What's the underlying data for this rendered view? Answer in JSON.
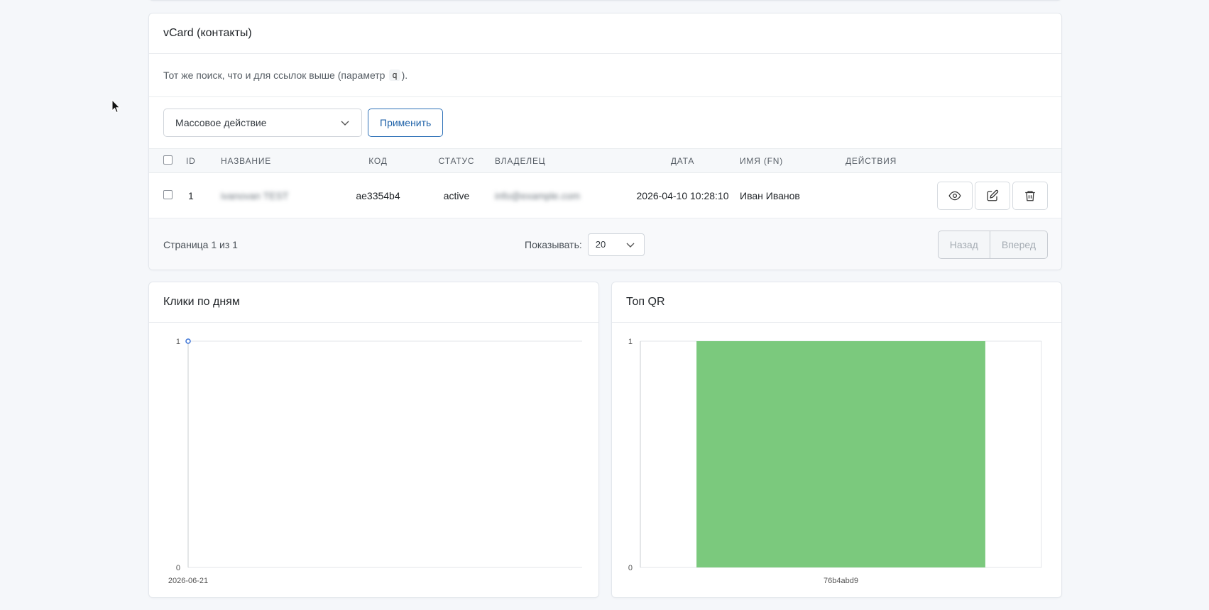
{
  "vcard": {
    "title": "vCard (контакты)",
    "hint_prefix": "Тот же поиск, что и для ссылок выше (параметр",
    "hint_code": "q",
    "hint_suffix": ").",
    "bulk_placeholder": "Массовое действие",
    "apply_label": "Применить",
    "columns": [
      "ID",
      "НАЗВАНИЕ",
      "КОД",
      "СТАТУС",
      "ВЛАДЕЛЕЦ",
      "ДАТА",
      "ИМЯ (FN)",
      "ДЕЙСТВИЯ"
    ],
    "rows": [
      {
        "id": "1",
        "name": "ivanovan TEST",
        "code": "ae3354b4",
        "status": "active",
        "owner": "info@example.com",
        "date": "2026-04-10 10:28:10",
        "fn": "Иван Иванов",
        "actions": [
          "eye-icon",
          "edit-icon",
          "trash-icon"
        ]
      }
    ],
    "footer": {
      "page_info": "Страница 1 из 1",
      "per_page_label": "Показывать:",
      "per_page_value": "20",
      "prev_label": "Назад",
      "next_label": "Вперед"
    }
  },
  "clicks_chart": {
    "title": "Клики по дням",
    "chart_data": {
      "type": "line",
      "x": [
        "2026-06-21"
      ],
      "series": [
        {
          "values": [
            1
          ]
        }
      ],
      "ylim": [
        0,
        1
      ],
      "yticks": [
        "0",
        "1"
      ],
      "color": "#3b73d6",
      "grid": true
    }
  },
  "top_qr_chart": {
    "title": "Топ QR",
    "chart_data": {
      "type": "bar",
      "categories": [
        "76b4abd9"
      ],
      "values": [
        1
      ],
      "ylim": [
        0,
        1
      ],
      "yticks": [
        "0",
        "1"
      ],
      "color": "#7bc97d",
      "grid": true
    }
  }
}
